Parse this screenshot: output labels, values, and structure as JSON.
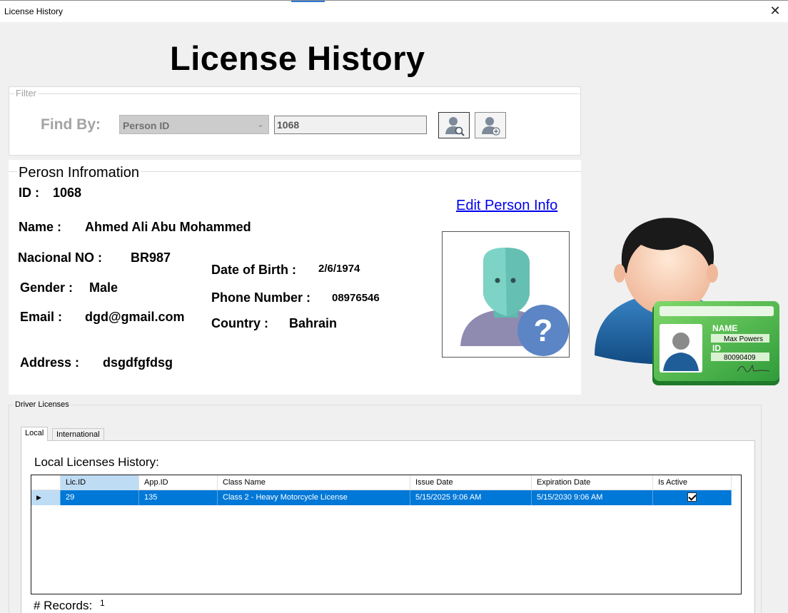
{
  "window": {
    "title": "License History",
    "close_glyph": "✕"
  },
  "header": {
    "title": "License History"
  },
  "filter": {
    "legend": "Filter",
    "find_by_label": "Find By:",
    "find_by_selected": "Person ID",
    "search_value": "1068",
    "icons": [
      "find-person-icon",
      "add-person-icon"
    ]
  },
  "person": {
    "legend": "Perosn Infromation",
    "id_label": "ID :",
    "id_value": "1068",
    "edit_link": "Edit Person Info",
    "name_label": "Name :",
    "name_value": "Ahmed Ali Abu Mohammed",
    "national_no_label": "Nacional NO :",
    "national_no_value": "BR987",
    "dob_label": "Date of Birth :",
    "dob_value": "2/6/1974",
    "gender_label": "Gender :",
    "gender_value": "Male",
    "phone_label": "Phone Number :",
    "phone_value": "08976546",
    "email_label": "Email :",
    "email_value": "dgd@gmail.com",
    "country_label": "Country :",
    "country_value": "Bahrain",
    "address_label": "Address :",
    "address_value": "dsgdfgfdsg"
  },
  "id_card": {
    "name_label": "NAME",
    "name_value": "Max Powers",
    "id_label": "ID",
    "id_value": "80090409"
  },
  "driver_licenses": {
    "legend": "Driver Licenses",
    "tabs": [
      {
        "label": "Local",
        "active": true
      },
      {
        "label": "International",
        "active": false
      }
    ],
    "section_title": "Local Licenses History:",
    "columns": [
      "Lic.ID",
      "App.ID",
      "Class Name",
      "Issue Date",
      "Expiration Date",
      "Is Active"
    ],
    "rows": [
      {
        "lic_id": "29",
        "app_id": "135",
        "class_name": "Class 2 - Heavy Motorcycle License",
        "issue_date": "5/15/2025 9:06 AM",
        "expiration_date": "5/15/2030 9:06 AM",
        "is_active": true
      }
    ],
    "records_label": "# Records:",
    "records_count": "1"
  },
  "colors": {
    "selection": "#0078d7",
    "link": "#0000ee",
    "card_green": "#3cb043"
  }
}
